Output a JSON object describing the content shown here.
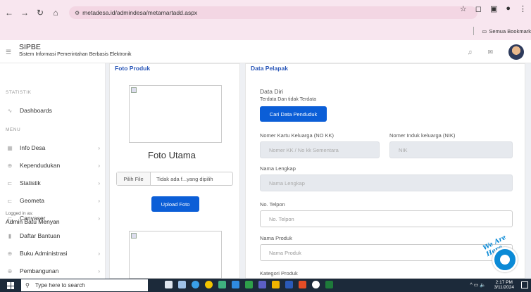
{
  "browser": {
    "url_host": "metadesa.id",
    "url_path": "/admindesa/metamartadd.aspx",
    "bookmarks_label": "Semua Bookmark"
  },
  "app": {
    "title": "SIPBE",
    "subtitle": "Sistem Informasi Pemerintahan Berbasis Elektronik"
  },
  "sidebar": {
    "section_statistik": "STATISTIK",
    "section_menu": "MENU",
    "dashboards": "Dashboards",
    "items": [
      {
        "label": "Info Desa"
      },
      {
        "label": "Kependudukan"
      },
      {
        "label": "Statistik"
      },
      {
        "label": "Geometa"
      },
      {
        "label": "Canvaser"
      },
      {
        "label": "Daftar Bantuan"
      },
      {
        "label": "Buku Administrasi"
      },
      {
        "label": "Pembangunan"
      }
    ],
    "logged_in_label": "Logged in as:",
    "logged_in_user": "Admin Batu Menyan"
  },
  "foto": {
    "card_title": "Foto Produk",
    "main_label": "Foto Utama",
    "pilih_file": "Pilih File",
    "no_file": "Tidak ada f...yang dipilih",
    "upload": "Upload Foto"
  },
  "pelapak": {
    "card_title": "Data Pelapak",
    "data_diri": "Data Diri",
    "terdata": "Terdata Dan tidak Terdata",
    "cari_button": "Cari Data Penduduk",
    "no_kk_label": "Nomer Kartu Keluarga (NO KK)",
    "no_kk_placeholder": "Nomer KK / No kk Sementara",
    "nik_label": "Nomer Induk keluarga (NIK)",
    "nik_placeholder": "NIK",
    "nama_label": "Nama Lengkap",
    "nama_placeholder": "Nama Lengkap",
    "telpon_label": "No. Telpon",
    "telpon_placeholder": "No. Telpon",
    "produk_label": "Nama Produk",
    "produk_placeholder": "Nama Produk",
    "kategori_label": "Kategori Produk"
  },
  "chat_widget": {
    "tagline": "We Are Here"
  },
  "taskbar": {
    "search_placeholder": "Type here to search",
    "time": "2:17 PM",
    "date": "3/11/2024"
  }
}
